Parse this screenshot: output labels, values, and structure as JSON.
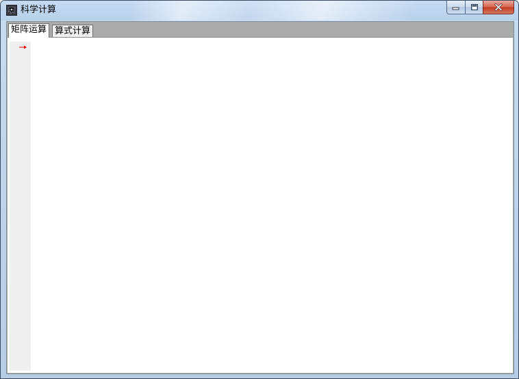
{
  "window": {
    "title": "科学计算",
    "icon": "app-icon",
    "caption_buttons": [
      "minimize-icon",
      "maximize-icon",
      "close-icon"
    ]
  },
  "tabs": [
    {
      "label": "矩阵运算",
      "active": true
    },
    {
      "label": "算式计算",
      "active": false
    }
  ],
  "editor": {
    "line_marker": "arrow-icon",
    "marker_color": "#e00000",
    "content": ""
  }
}
